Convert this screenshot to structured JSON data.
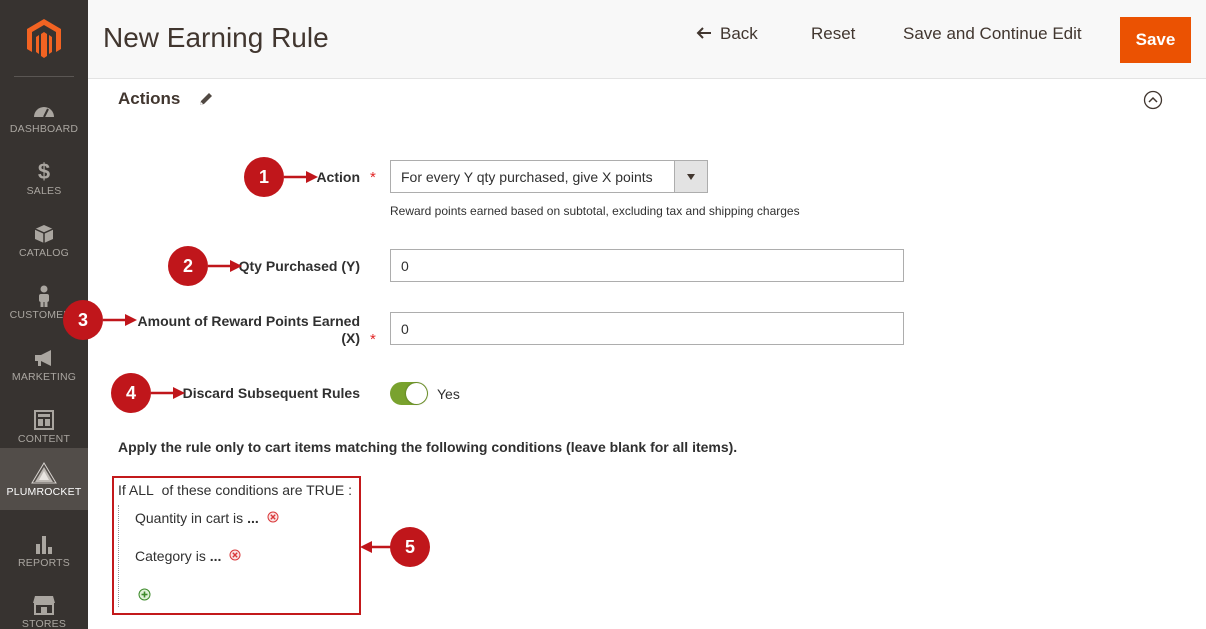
{
  "sidebar": {
    "items": [
      {
        "label": "DASHBOARD",
        "icon": "dashboard-icon"
      },
      {
        "label": "SALES",
        "icon": "dollar-icon"
      },
      {
        "label": "CATALOG",
        "icon": "box-icon"
      },
      {
        "label": "CUSTOMERS",
        "icon": "person-icon"
      },
      {
        "label": "MARKETING",
        "icon": "megaphone-icon"
      },
      {
        "label": "CONTENT",
        "icon": "layout-icon"
      },
      {
        "label": "PLUMROCKET",
        "icon": "pyramid-icon"
      },
      {
        "label": "REPORTS",
        "icon": "bar-chart-icon"
      },
      {
        "label": "STORES",
        "icon": "store-icon"
      }
    ]
  },
  "header": {
    "title": "New Earning Rule",
    "back_label": "Back",
    "reset_label": "Reset",
    "save_continue_label": "Save and Continue Edit",
    "save_label": "Save"
  },
  "section": {
    "title": "Actions"
  },
  "form": {
    "action_label": "Action",
    "action_value": "For every Y qty purchased, give X points",
    "action_note": "Reward points earned based on subtotal, excluding tax and shipping charges",
    "qty_label": "Qty Purchased (Y)",
    "qty_value": "0",
    "amount_label_line1": "Amount of Reward Points Earned",
    "amount_label_line2": "(X)",
    "amount_value": "0",
    "discard_label": "Discard Subsequent Rules",
    "discard_value": "Yes",
    "required_mark": "*"
  },
  "conditions": {
    "intro": "Apply the rule only to cart items matching the following conditions (leave blank for all items).",
    "head_if": "If",
    "head_all": "ALL",
    "head_mid": "of these conditions are",
    "head_true": "TRUE",
    "head_colon": ":",
    "rules": [
      {
        "attribute": "Quantity in cart",
        "operator": "is",
        "value": "..."
      },
      {
        "attribute": "Category",
        "operator": "is",
        "value": "..."
      }
    ]
  },
  "annotations": [
    "1",
    "2",
    "3",
    "4",
    "5"
  ],
  "colors": {
    "sidebar_bg": "#373330",
    "accent": "#eb5202",
    "toggle_on": "#79a22e",
    "annotation_red": "#c0161b"
  }
}
